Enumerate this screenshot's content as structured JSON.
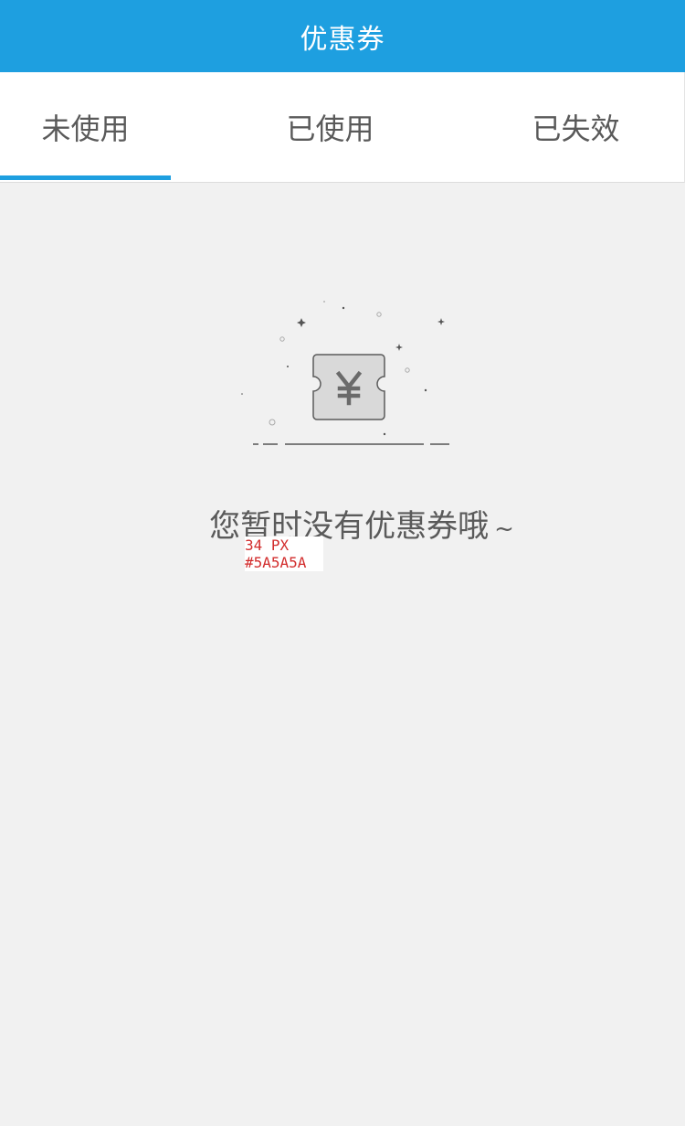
{
  "header": {
    "title": "优惠券"
  },
  "tabs": [
    {
      "label": "未使用",
      "active": true
    },
    {
      "label": "已使用",
      "active": false
    },
    {
      "label": "已失效",
      "active": false
    }
  ],
  "empty_state": {
    "icon": "coupon-yen-icon",
    "message": "您暂时没有优惠券哦",
    "tilde": "~"
  },
  "annotation": {
    "font_size": "34 PX",
    "color": "#5A5A5A"
  },
  "colors": {
    "accent": "#1e9fe0",
    "text": "#5a5a5a",
    "background": "#f1f1f1",
    "annotation": "#d22c2c"
  }
}
